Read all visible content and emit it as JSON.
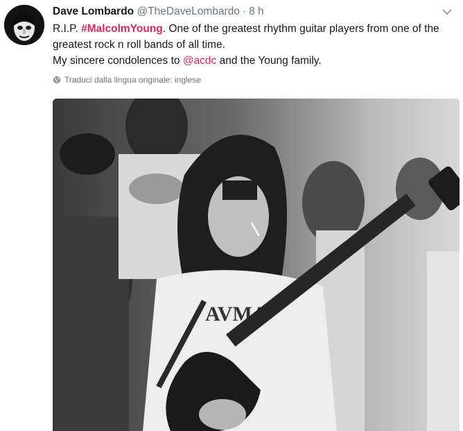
{
  "tweet": {
    "author_name": "Dave Lombardo",
    "author_handle": "@TheDaveLombardo",
    "separator": "·",
    "time": "8 h",
    "text_prefix": "R.I.P. ",
    "hashtag": "#MalcolmYoung",
    "text_after_hashtag": ". One of the greatest rhythm guitar players from one of the greatest rock n roll bands of all time.",
    "text_line2_prefix": "My sincere condolences to ",
    "mention": "@acdc",
    "text_line2_suffix": " and the Young family.",
    "translate_label": "Traduci dalla lingua originale: inglese"
  },
  "colors": {
    "link": "#e0245e",
    "meta": "#657786",
    "text": "#14171a"
  },
  "icons": {
    "caret": "chevron-down-icon",
    "translate": "globe-icon"
  }
}
